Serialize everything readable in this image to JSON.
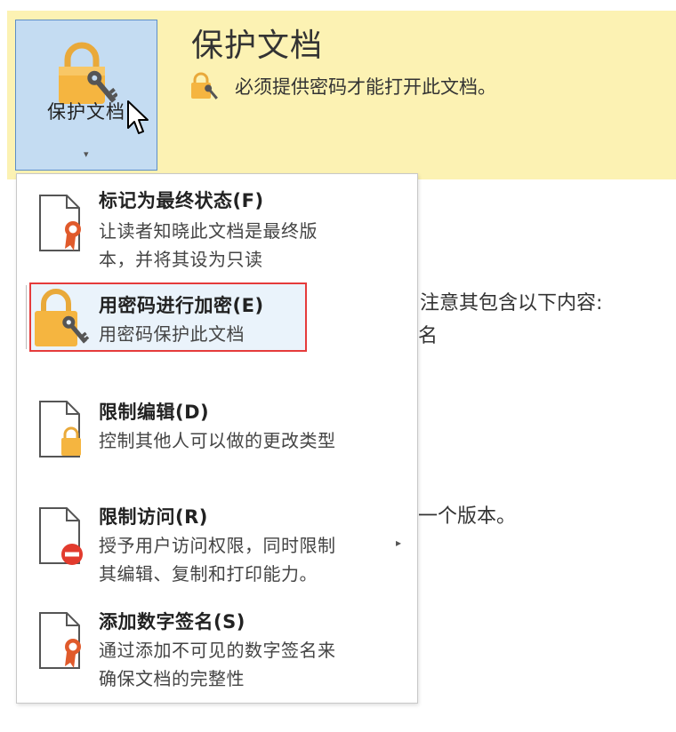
{
  "header": {
    "button_label": "保护文档",
    "title": "保护文档",
    "description": "必须提供密码才能打开此文档。"
  },
  "background_text": {
    "line1": "注意其包含以下内容:",
    "line2": "名",
    "line3": "一个版本。"
  },
  "menu": {
    "items": [
      {
        "title": "标记为最终状态(F)",
        "desc": [
          "让读者知晓此文档是最终版",
          "本，并将其设为只读"
        ],
        "icon": "final-ribbon-icon"
      },
      {
        "title": "用密码进行加密(E)",
        "desc": [
          "用密码保护此文档"
        ],
        "icon": "lock-key-icon"
      },
      {
        "title": "限制编辑(D)",
        "desc": [
          "控制其他人可以做的更改类型"
        ],
        "icon": "doc-lock-icon"
      },
      {
        "title": "限制访问(R)",
        "desc": [
          "授予用户访问权限，同时限制",
          "其编辑、复制和打印能力。"
        ],
        "icon": "doc-restrict-icon"
      },
      {
        "title": "添加数字签名(S)",
        "desc": [
          "通过添加不可见的数字签名来",
          "确保文档的完整性"
        ],
        "icon": "signature-ribbon-icon"
      }
    ],
    "submenu_arrow": "▸"
  },
  "colors": {
    "band": "#fcf2b3",
    "button_bg": "#c4dcf2",
    "lock": "#f5b540",
    "highlight_border": "#e53b3b"
  }
}
